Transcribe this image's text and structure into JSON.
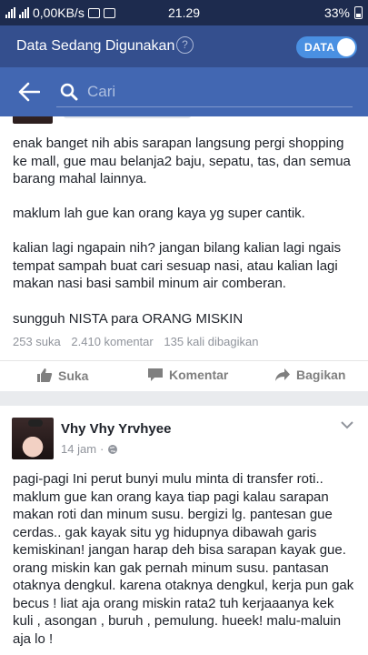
{
  "status_bar": {
    "data_speed": "0,00KB/s",
    "time": "21.29",
    "battery": "33%"
  },
  "data_bar": {
    "title": "Data Sedang Digunakan",
    "help": "?",
    "toggle_label": "DATA"
  },
  "search": {
    "placeholder": "Cari"
  },
  "post1": {
    "paragraphs": [
      "enak banget nih abis sarapan langsung pergi shopping ke mall, gue mau belanja2 baju, sepatu, tas, dan semua barang mahal lainnya.",
      "maklum lah gue kan orang kaya yg super cantik.",
      "kalian lagi ngapain nih? jangan bilang kalian lagi ngais tempat sampah buat cari sesuap nasi, atau kalian lagi makan nasi basi sambil minum air comberan.",
      "sungguh NISTA para ORANG MISKIN"
    ],
    "likes": "253 suka",
    "comments": "2.410 komentar",
    "shares": "135 kali dibagikan",
    "like_label": "Suka",
    "comment_label": "Komentar",
    "share_label": "Bagikan"
  },
  "post2": {
    "author": "Vhy Vhy Yrvhyee",
    "time": "14 jam",
    "text": "pagi-pagi Ini perut bunyi mulu minta di transfer roti.. maklum gue kan orang kaya tiap pagi kalau sarapan makan roti dan minum susu. bergizi lg. pantesan gue cerdas.. gak kayak situ yg hidupnya dibawah garis kemiskinan! jangan harap deh bisa sarapan kayak gue. orang miskin kan gak pernah minum susu. pantasan otaknya dengkul. karena otaknya dengkul, kerja pun gak becus ! liat aja orang miskin rata2 tuh kerjaaanya kek kuli , asongan , buruh , pemulung. hueek! malu-maluin aja lo !"
  },
  "colors": {
    "status_bar": "#1d2b4e",
    "data_bar": "#344f8e",
    "header": "#4267b2",
    "toggle": "#4a90e2",
    "background": "#e9ebee"
  }
}
